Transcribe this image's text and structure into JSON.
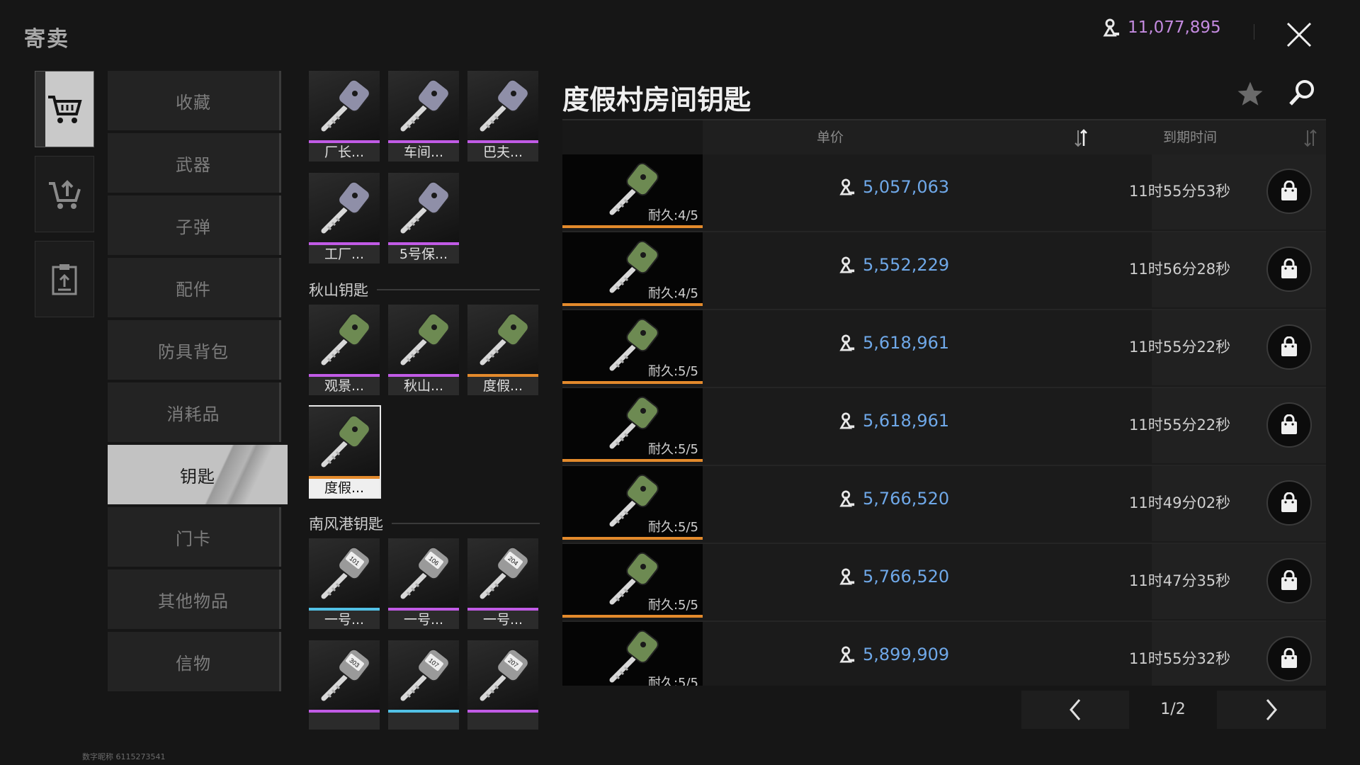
{
  "header": {
    "title": "寄卖",
    "currency_amount": "11,077,895"
  },
  "left_tabs": [
    {
      "icon": "cart-icon",
      "active": true
    },
    {
      "icon": "cart-upload-icon",
      "active": false
    },
    {
      "icon": "clipboard-icon",
      "active": false
    }
  ],
  "categories": [
    {
      "label": "收藏",
      "active": false
    },
    {
      "label": "武器",
      "active": false
    },
    {
      "label": "子弹",
      "active": false
    },
    {
      "label": "配件",
      "active": false
    },
    {
      "label": "防具背包",
      "active": false
    },
    {
      "label": "消耗品",
      "active": false
    },
    {
      "label": "钥匙",
      "active": true
    },
    {
      "label": "门卡",
      "active": false
    },
    {
      "label": "其他物品",
      "active": false
    },
    {
      "label": "信物",
      "active": false
    }
  ],
  "item_groups": [
    {
      "title": "",
      "items": [
        {
          "label": "厂长...",
          "rarity_color": "#c15be6",
          "key_color": "#8f8fa8"
        },
        {
          "label": "车间...",
          "rarity_color": "#c15be6",
          "key_color": "#8f8fa8"
        },
        {
          "label": "巴夫...",
          "rarity_color": "#c15be6",
          "key_color": "#8f8fa8"
        },
        {
          "label": "工厂...",
          "rarity_color": "#c15be6",
          "key_color": "#8f8fa8"
        },
        {
          "label": "5号保...",
          "rarity_color": "#c15be6",
          "key_color": "#8f8fa8"
        }
      ]
    },
    {
      "title": "秋山钥匙",
      "items": [
        {
          "label": "观景...",
          "rarity_color": "#c15be6",
          "key_color": "#6d8a52"
        },
        {
          "label": "秋山...",
          "rarity_color": "#c15be6",
          "key_color": "#6d8a52"
        },
        {
          "label": "度假...",
          "rarity_color": "#e38a2c",
          "key_color": "#6d8a52"
        },
        {
          "label": "度假...",
          "rarity_color": "#e38a2c",
          "key_color": "#6d8a52",
          "selected": true
        }
      ]
    },
    {
      "title": "南风港钥匙",
      "items": [
        {
          "label": "一号...",
          "rarity_color": "#52c1e6",
          "key_color": "#9a9a9a",
          "tag": "101"
        },
        {
          "label": "一号...",
          "rarity_color": "#c15be6",
          "key_color": "#9a9a9a",
          "tag": "106"
        },
        {
          "label": "一号...",
          "rarity_color": "#c15be6",
          "key_color": "#9a9a9a",
          "tag": "204"
        },
        {
          "label": "",
          "rarity_color": "#c15be6",
          "key_color": "#9a9a9a",
          "tag": "303"
        },
        {
          "label": "",
          "rarity_color": "#52c1e6",
          "key_color": "#9a9a9a",
          "tag": "107"
        },
        {
          "label": "",
          "rarity_color": "#c15be6",
          "key_color": "#9a9a9a",
          "tag": "207"
        }
      ]
    }
  ],
  "listing": {
    "title": "度假村房间钥匙",
    "col_price": "单价",
    "col_expiry": "到期时间",
    "rows": [
      {
        "durability": "耐久:4/5",
        "price": "5,057,063",
        "expiry": "11时55分53秒"
      },
      {
        "durability": "耐久:4/5",
        "price": "5,552,229",
        "expiry": "11时56分28秒"
      },
      {
        "durability": "耐久:5/5",
        "price": "5,618,961",
        "expiry": "11时55分22秒"
      },
      {
        "durability": "耐久:5/5",
        "price": "5,618,961",
        "expiry": "11时55分22秒"
      },
      {
        "durability": "耐久:5/5",
        "price": "5,766,520",
        "expiry": "11时49分02秒"
      },
      {
        "durability": "耐久:5/5",
        "price": "5,766,520",
        "expiry": "11时47分35秒"
      },
      {
        "durability": "耐久:5/5",
        "price": "5,899,909",
        "expiry": "11时55分32秒"
      }
    ]
  },
  "pagination": {
    "page": "1/2"
  },
  "footer": {
    "text": "数字昵称 6115273541"
  },
  "colors": {
    "accent_currency": "#c48be0",
    "price": "#6fa8e8",
    "rarity_orange": "#e38a2c"
  }
}
